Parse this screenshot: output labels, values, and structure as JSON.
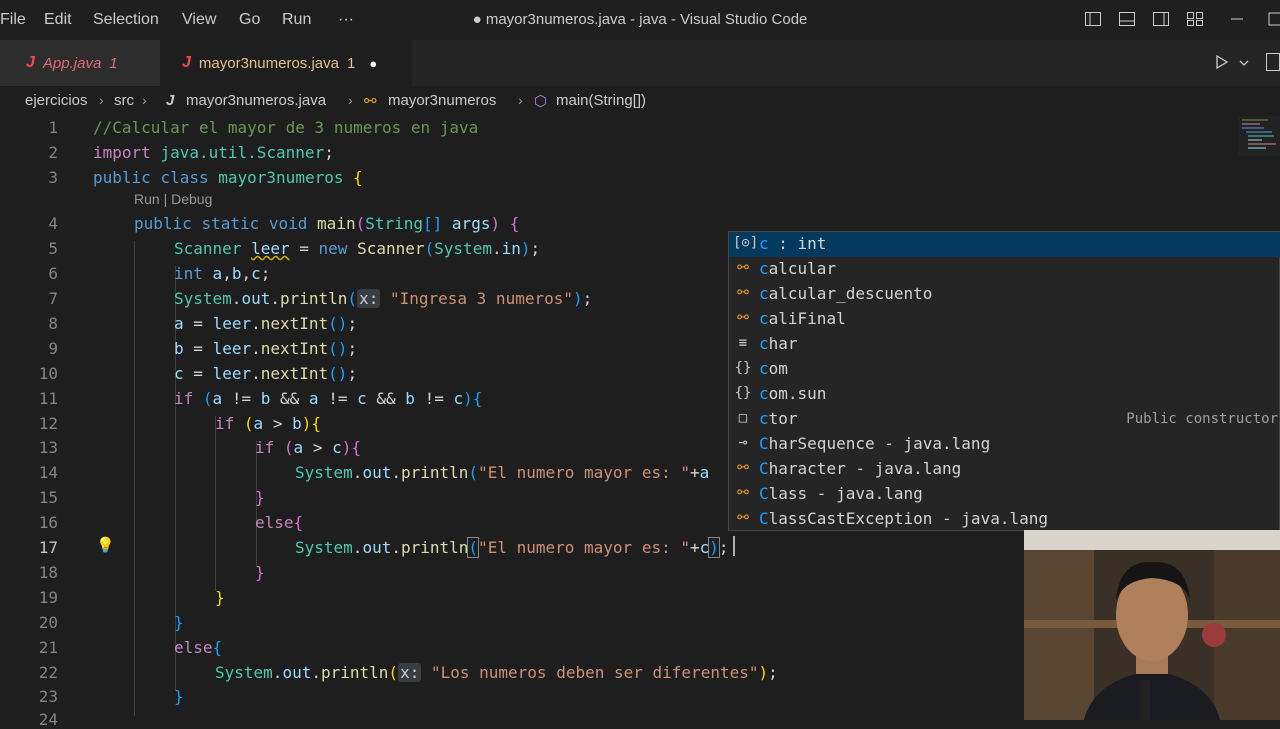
{
  "menu": [
    "File",
    "Edit",
    "Selection",
    "View",
    "Go",
    "Run",
    "···"
  ],
  "window_title": "● mayor3numeros.java - java - Visual Studio Code",
  "tabs": [
    {
      "icon": "J",
      "label": "App.java",
      "badge": "1"
    },
    {
      "icon": "J",
      "label": "mayor3numeros.java",
      "badge": "1",
      "dirty": "●"
    }
  ],
  "breadcrumb": {
    "folder": "ejercicios",
    "src": "src",
    "file": "mayor3numeros.java",
    "class": "mayor3numeros",
    "method": "main(String[])"
  },
  "codelens": "Run | Debug",
  "line_numbers": [
    "1",
    "2",
    "3",
    "4",
    "5",
    "6",
    "7",
    "8",
    "9",
    "10",
    "11",
    "12",
    "13",
    "14",
    "15",
    "16",
    "17",
    "18",
    "19",
    "20",
    "21",
    "22",
    "23",
    "24"
  ],
  "code": [
    "//Calcular el mayor de 3 numeros en java",
    "import java.util.Scanner;",
    "public class mayor3numeros {",
    "public static void main(String[] args) {",
    "Scanner leer = new Scanner(System.in);",
    "int a,b,c;",
    "System.out.println(x: \"Ingresa 3 numeros\");",
    "a = leer.nextInt();",
    "b = leer.nextInt();",
    "c = leer.nextInt();",
    "if (a != b && a != c && b != c){",
    "if (a > b){",
    "if (a > c){",
    "System.out.println(\"El numero mayor es: \"+a",
    "}",
    "else{",
    "System.out.println(\"El numero mayor es: \"+c);",
    "}",
    "}",
    "}",
    "else{",
    "System.out.println(x: \"Los numeros deben ser diferentes\");",
    "}"
  ],
  "tokens": {
    "comment": "//Calcular el mayor de 3 numeros en java",
    "import": "import",
    "java_util_scanner": "java.util.Scanner",
    "semi": ";",
    "public": "public",
    "class": "class",
    "static": "static",
    "void": "void",
    "new": "new",
    "int": "int",
    "if": "if",
    "else": "else",
    "class_name": "mayor3numeros",
    "main": "main",
    "String": "String",
    "args": "args",
    "Scanner": "Scanner",
    "leer": "leer",
    "System": "System",
    "in": "in",
    "out": "out",
    "println": "println",
    "nextInt": "nextInt",
    "a": "a",
    "b": "b",
    "c": "c",
    "hint_x": "x:",
    "str_ingresa": "\"Ingresa 3 numeros\"",
    "str_mayor": "\"El numero mayor es: \"",
    "str_diferentes": "\"Los numeros deben ser diferentes\""
  },
  "suggestions": [
    {
      "icon": "[⊙]",
      "prefix": "c",
      "rest": " : int",
      "detail": "",
      "selected": true
    },
    {
      "icon": "⚯",
      "prefix": "c",
      "rest": "alcular",
      "detail": ""
    },
    {
      "icon": "⚯",
      "prefix": "c",
      "rest": "alcular_descuento",
      "detail": ""
    },
    {
      "icon": "⚯",
      "prefix": "c",
      "rest": "aliFinal",
      "detail": ""
    },
    {
      "icon": "≡",
      "prefix": "c",
      "rest": "har",
      "detail": ""
    },
    {
      "icon": "{}",
      "prefix": "c",
      "rest": "om",
      "detail": ""
    },
    {
      "icon": "{}",
      "prefix": "c",
      "rest": "om.sun",
      "detail": ""
    },
    {
      "icon": "□",
      "prefix": "c",
      "rest": "tor",
      "detail": "Public constructor"
    },
    {
      "icon": "⊸",
      "prefix": "C",
      "rest": "harSequence - java.lang",
      "detail": ""
    },
    {
      "icon": "⚯",
      "prefix": "C",
      "rest": "haracter - java.lang",
      "detail": ""
    },
    {
      "icon": "⚯",
      "prefix": "C",
      "rest": "lass - java.lang",
      "detail": ""
    },
    {
      "icon": "⚯",
      "prefix": "C",
      "rest": "lassCastException - java.lang",
      "detail": ""
    }
  ],
  "colors": {
    "accent": "#007acc",
    "editor_bg": "#1e1e1e",
    "keyword": "#569cd6",
    "string": "#ce9178",
    "type": "#4ec9b0",
    "comment": "#6a9955"
  }
}
